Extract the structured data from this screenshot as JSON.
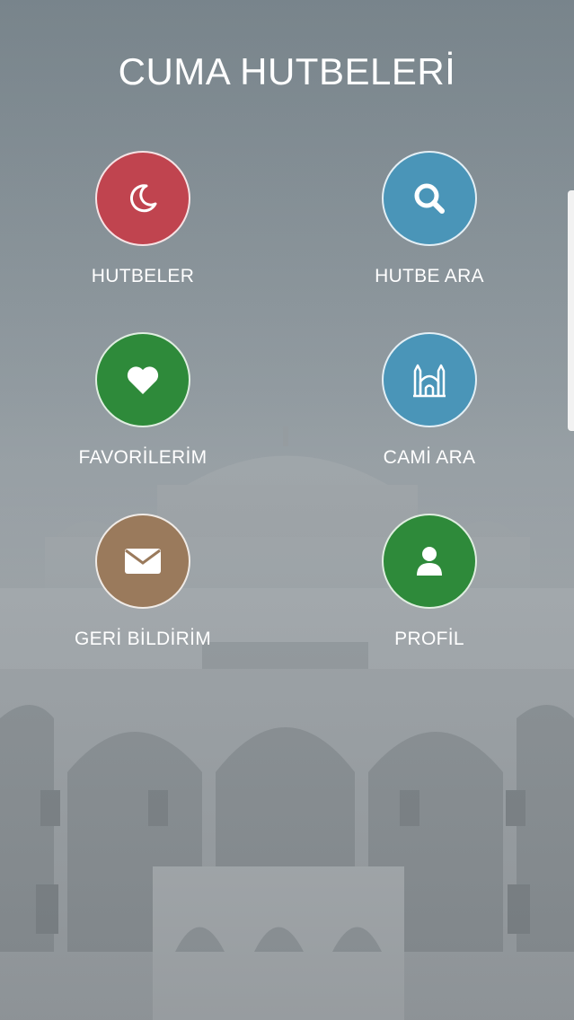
{
  "app": {
    "title": "CUMA HUTBELERİ"
  },
  "menu": {
    "items": [
      {
        "label": "HUTBELER",
        "icon": "moon-icon",
        "color": "#c0444f"
      },
      {
        "label": "HUTBE ARA",
        "icon": "search-icon",
        "color": "#4a95b8"
      },
      {
        "label": "FAVORİLERİM",
        "icon": "heart-icon",
        "color": "#2e8a3a"
      },
      {
        "label": "CAMİ ARA",
        "icon": "mosque-icon",
        "color": "#4a95b8"
      },
      {
        "label": "GERİ BİLDİRİM",
        "icon": "envelope-icon",
        "color": "#9a7a5c"
      },
      {
        "label": "PROFİL",
        "icon": "user-icon",
        "color": "#2e8a3a"
      }
    ]
  }
}
